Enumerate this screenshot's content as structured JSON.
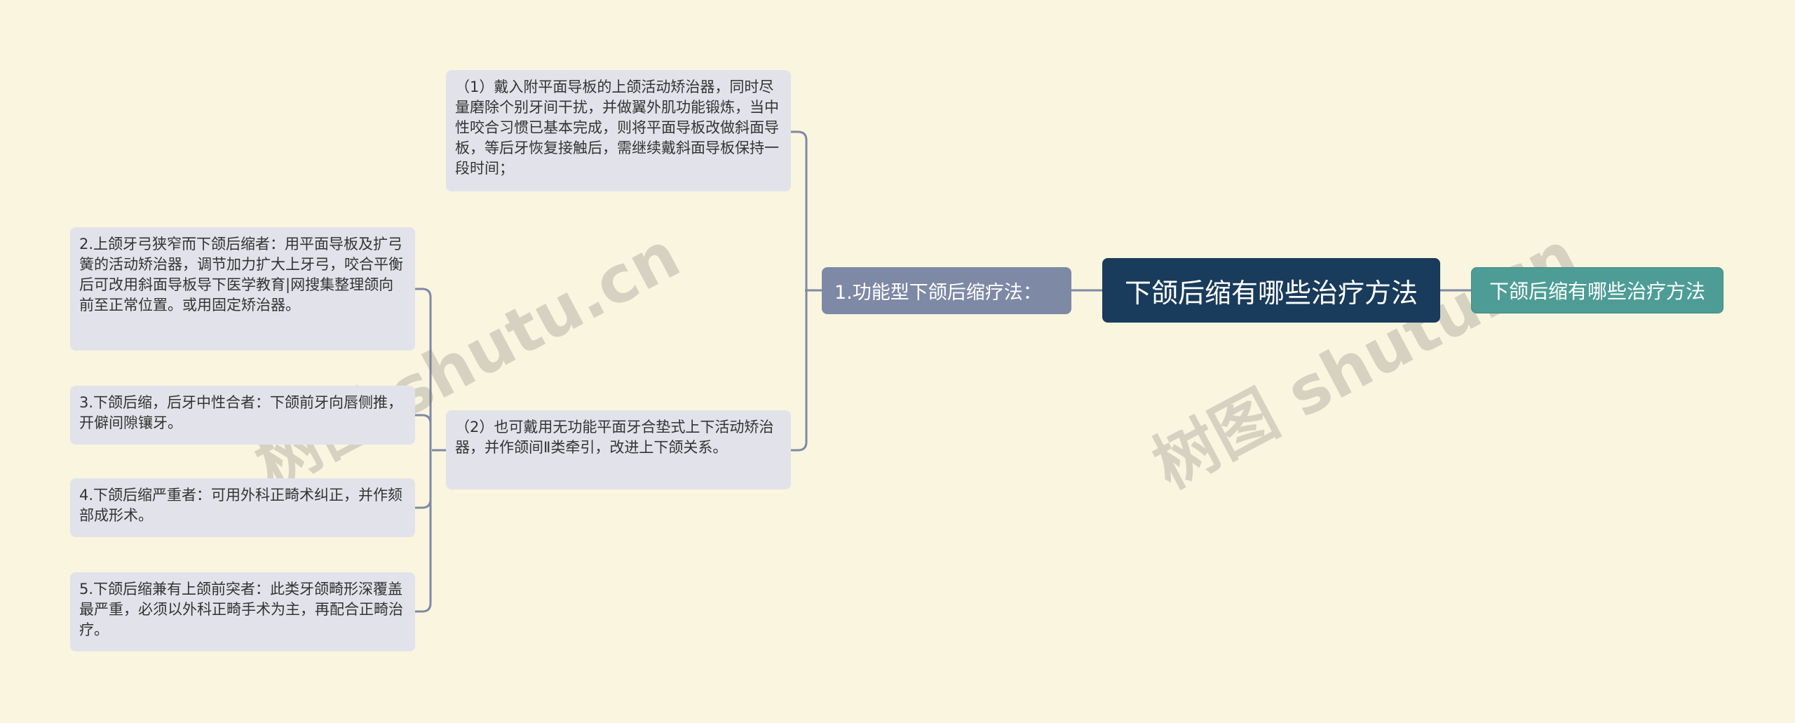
{
  "colors": {
    "background": "#faf5df",
    "root": "#193b5c",
    "mid": "#7e89a6",
    "leaf": "#e2e3ea",
    "alt": "#4d9d96",
    "line": "#7e89a6"
  },
  "root": {
    "label": "下颌后缩有哪些治疗方法"
  },
  "alt_topic": {
    "label": "下颌后缩有哪些治疗方法"
  },
  "branch": {
    "label": "1.功能型下颌后缩疗法："
  },
  "sub_items": [
    {
      "text": "（1）戴入附平面导板的上颌活动矫治器，同时尽量磨除个别牙间干扰，并做翼外肌功能锻炼，当中性咬合习惯已基本完成，则将平面导板改做斜面导板，等后牙恢复接触后，需继续戴斜面导板保持一段时间；"
    },
    {
      "text": "（2）也可戴用无功能平面牙合垫式上下活动矫治器，并作颌间Ⅱ类牵引，改进上下颌关系。"
    }
  ],
  "leaf_items": [
    {
      "text": "2.上颌牙弓狭窄而下颌后缩者：用平面导板及扩弓簧的活动矫治器，调节加力扩大上牙弓，咬合平衡后可改用斜面导板导下医学教育|网搜集整理颌向前至正常位置。或用固定矫治器。"
    },
    {
      "text": "3.下颌后缩，后牙中性合者：下颌前牙向唇侧推，开僻间隙镶牙。"
    },
    {
      "text": "4.下颌后缩严重者：可用外科正畸术纠正，并作颏部成形术。"
    },
    {
      "text": "5.下颌后缩兼有上颌前突者：此类牙颌畸形深覆盖最严重，必须以外科正畸手术为主，再配合正畸治疗。"
    }
  ],
  "watermarks": [
    "树图 shutu.cn",
    "树图 shutu.cn"
  ]
}
